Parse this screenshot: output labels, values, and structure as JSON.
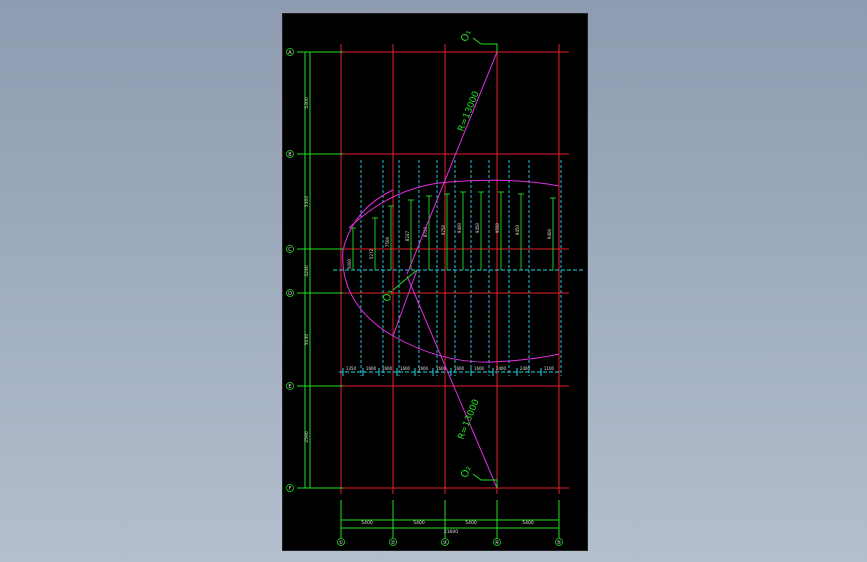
{
  "drawing": {
    "row_axes": [
      {
        "label": "A"
      },
      {
        "label": "B"
      },
      {
        "label": "C"
      },
      {
        "label": "D"
      },
      {
        "label": "E"
      },
      {
        "label": "F"
      }
    ],
    "column_axes": [
      {
        "label": "①"
      },
      {
        "label": "②"
      },
      {
        "label": "③"
      },
      {
        "label": "④"
      },
      {
        "label": "⑤"
      }
    ],
    "row_dims": [
      "5300",
      "5300",
      "4240",
      "5030",
      "2590"
    ],
    "col_dims": [
      "5400",
      "5400",
      "5400",
      "5400"
    ],
    "overall_dim": "21600",
    "radius_upper": "R=13000",
    "radius_lower": "R=13000",
    "center_top": "O₁",
    "center_bottom": "O₂",
    "center_mid": "O₃",
    "ordinates": [
      "5000",
      "5272",
      "7500",
      "8247",
      "8750",
      "9250",
      "9400",
      "9450",
      "9550",
      "9450",
      "9400"
    ],
    "bottom_chain": [
      "1350",
      "1600",
      "1600",
      "1600",
      "1600",
      "1600",
      "1600",
      "1600",
      "2400",
      "2400",
      "1100"
    ]
  }
}
